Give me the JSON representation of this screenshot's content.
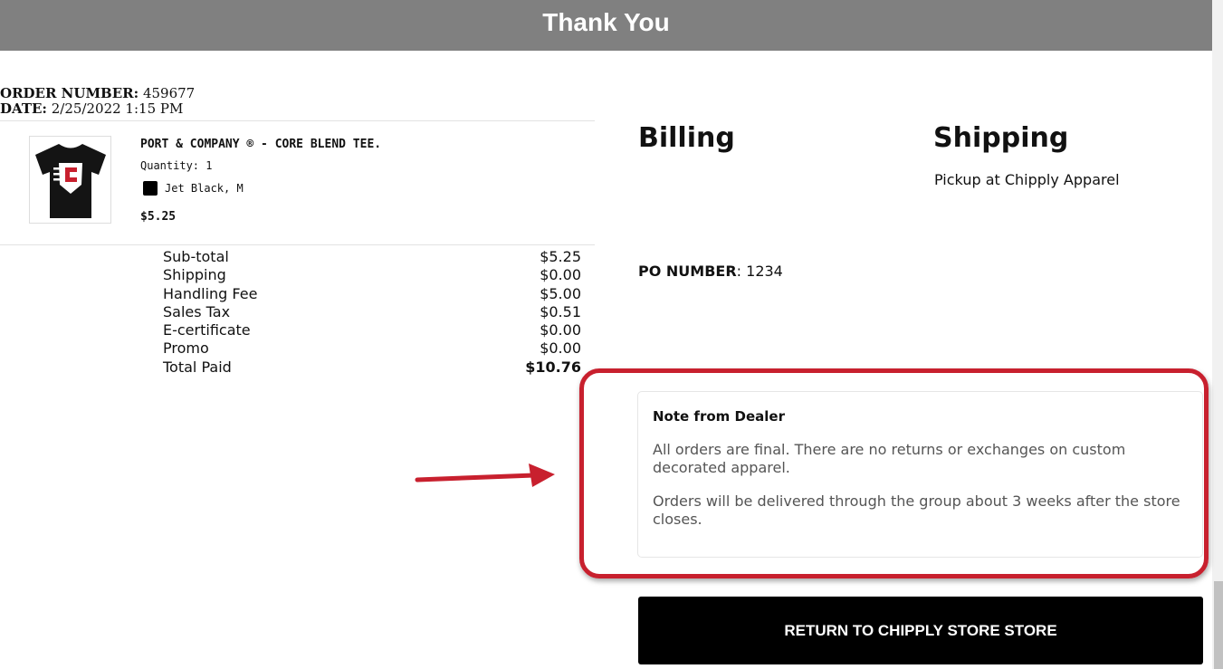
{
  "header": {
    "title": "Thank You"
  },
  "order": {
    "number_label": "ORDER NUMBER:",
    "number_value": "459677",
    "date_label": "DATE:",
    "date_value": "2/25/2022 1:15 PM"
  },
  "item": {
    "name": "PORT & COMPANY ® - CORE BLEND TEE.",
    "quantity": "Quantity: 1",
    "variant": "Jet Black, M",
    "price": "$5.25",
    "swatch_color": "#000000",
    "image_icon": "black-tshirt-icon"
  },
  "totals": [
    {
      "label": "Sub-total",
      "amount": "$5.25"
    },
    {
      "label": "Shipping",
      "amount": "$0.00"
    },
    {
      "label": "Handling Fee",
      "amount": "$5.00"
    },
    {
      "label": "Sales Tax",
      "amount": "$0.51"
    },
    {
      "label": "E-certificate",
      "amount": "$0.00"
    },
    {
      "label": "Promo",
      "amount": "$0.00"
    },
    {
      "label": "Total Paid",
      "amount": "$10.76"
    }
  ],
  "billing": {
    "heading": "Billing"
  },
  "shipping": {
    "heading": "Shipping",
    "text": "Pickup at Chipply Apparel"
  },
  "po": {
    "label": "PO NUMBER",
    "value": ": 1234"
  },
  "note": {
    "title": "Note from Dealer",
    "paragraph1": "All orders are final. There are no returns or exchanges on custom decorated apparel.",
    "paragraph2": "Orders will be delivered through the group about 3 weeks after the store closes."
  },
  "return_button": {
    "label": "RETURN TO CHIPPLY STORE STORE"
  },
  "colors": {
    "header_bg": "#808080",
    "highlight": "#c8202e",
    "button_bg": "#000000"
  }
}
